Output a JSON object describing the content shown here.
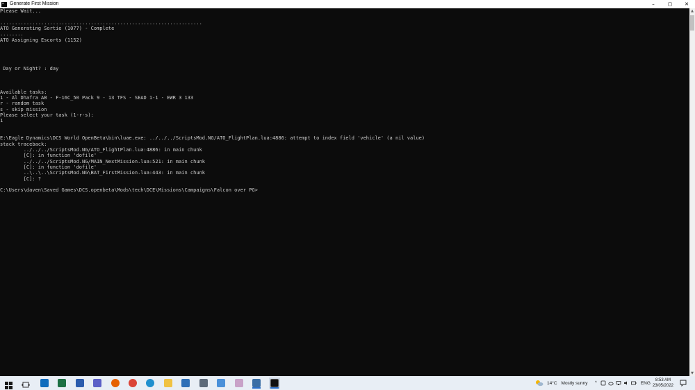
{
  "window": {
    "title": "Generate First Mission",
    "controls": {
      "minimize": "–",
      "maximize": "▢",
      "close": "✕"
    }
  },
  "console": {
    "lines": [
      "Please Wait...",
      "",
      ".....................................................................",
      "ATO Generating Sortie (1077) - Complete",
      "........",
      "ATO Assigning Escorts (1152)",
      "",
      "",
      "",
      "",
      " Day or Night? : day",
      "",
      "",
      "",
      "Available tasks:",
      "1 - Al Dhafra AB - F-16C_50 Pack 9 - 13 TFS - SEAD 1-1 - EWR 3 133",
      "r - random task",
      "s - skip mission",
      "Please select your task (1-r-s):",
      "1",
      "",
      "",
      "E:\\Eagle Dynamics\\DCS World OpenBeta\\bin\\luae.exe: ../../../ScriptsMod.NG/ATO_FlightPlan.lua:4886: attempt to index field 'vehicle' (a nil value)",
      "stack traceback:",
      "        ../../../ScriptsMod.NG/ATO_FlightPlan.lua:4886: in main chunk",
      "        [C]: in function 'dofile'",
      "        ../../../ScriptsMod.NG/MAIN_NextMission.lua:521: in main chunk",
      "        [C]: in function 'dofile'",
      "        ..\\..\\..\\ScriptsMod.NG\\BAT_FirstMission.lua:443: in main chunk",
      "        [C]: ?",
      "",
      "C:\\Users\\daven\\Saved Games\\DCS.openbeta\\Mods\\tech\\DCE\\Missions\\Campaigns\\Falcon over PG>"
    ]
  },
  "taskbar": {
    "apps": [
      {
        "name": "start-button",
        "icon": "windows-logo-icon",
        "color": "#1a1a1a"
      },
      {
        "name": "task-view-button",
        "icon": "task-view-icon",
        "color": "#333333"
      },
      {
        "name": "outlook-app",
        "icon": "outlook-icon",
        "color": "#0f6cbd"
      },
      {
        "name": "excel-app",
        "icon": "excel-icon",
        "color": "#1d7044"
      },
      {
        "name": "word-app",
        "icon": "word-icon",
        "color": "#2b5cad"
      },
      {
        "name": "teams-app",
        "icon": "teams-icon",
        "color": "#5b5fc7"
      },
      {
        "name": "firefox-app",
        "icon": "firefox-icon",
        "color": "#e66000"
      },
      {
        "name": "chrome-app",
        "icon": "chrome-icon",
        "color": "#db4437"
      },
      {
        "name": "edge-app",
        "icon": "edge-icon",
        "color": "#1f8fce"
      },
      {
        "name": "file-explorer-app",
        "icon": "folder-icon",
        "color": "#f0c243"
      },
      {
        "name": "store-app",
        "icon": "store-icon",
        "color": "#2f6fb7"
      },
      {
        "name": "calculator-app",
        "icon": "calculator-icon",
        "color": "#5d6a7a"
      },
      {
        "name": "remote-desktop-app",
        "icon": "remote-desktop-icon",
        "color": "#4a90d9"
      },
      {
        "name": "paint-app",
        "icon": "paint-icon",
        "color": "#c8a2c8"
      },
      {
        "name": "dcs-app",
        "icon": "jet-icon",
        "color": "#3a6ea5",
        "active": true
      },
      {
        "name": "command-prompt-app",
        "icon": "command-prompt-icon",
        "color": "#111111",
        "active": true
      }
    ],
    "weather": {
      "icon": "partly-sunny-icon",
      "temp": "14°C",
      "condition": "Mostly sunny"
    },
    "tray": {
      "chevron": "^",
      "language": "ENG"
    },
    "clock": {
      "time": "8:53 AM",
      "date": "23/05/2022"
    },
    "notifications_icon": "notification-icon"
  }
}
